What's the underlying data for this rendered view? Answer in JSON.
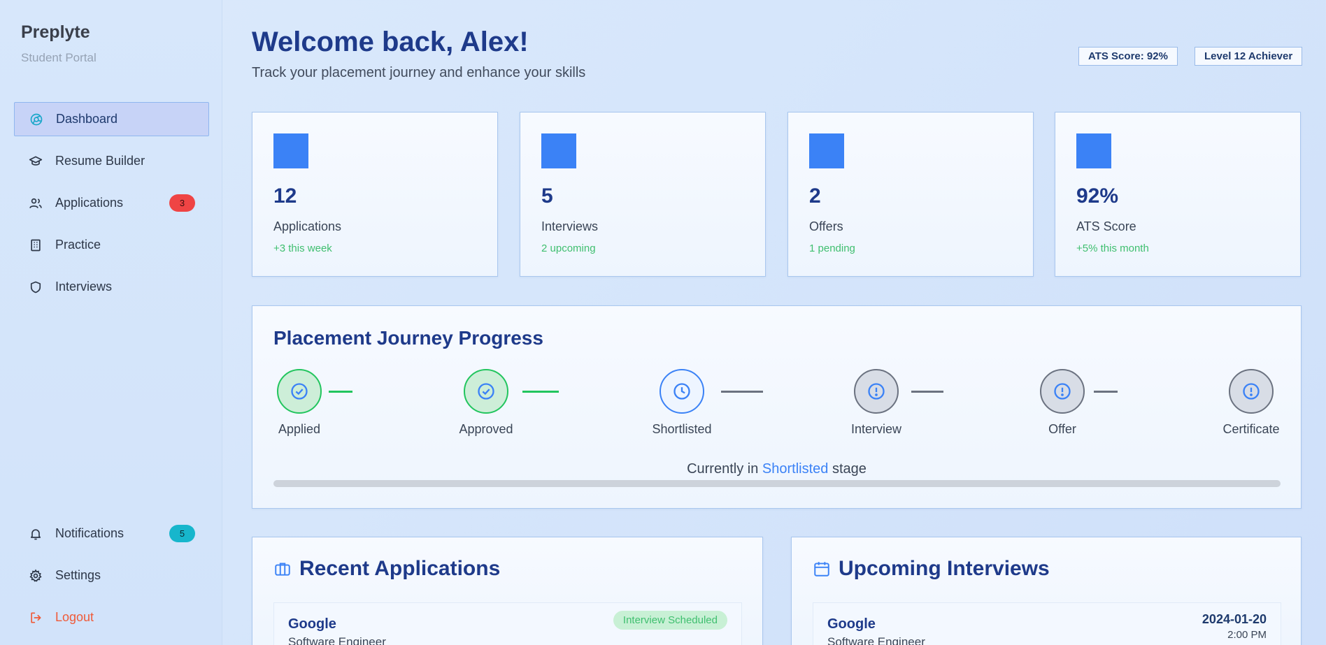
{
  "brand": {
    "name": "Preplyte",
    "subtitle": "Student Portal"
  },
  "nav": {
    "items": [
      {
        "label": "Dashboard",
        "icon": "dashboard-icon",
        "active": true
      },
      {
        "label": "Resume Builder",
        "icon": "graduation-cap-icon"
      },
      {
        "label": "Applications",
        "icon": "users-icon",
        "badge": "3"
      },
      {
        "label": "Practice",
        "icon": "building-icon"
      },
      {
        "label": "Interviews",
        "icon": "shield-icon"
      }
    ],
    "bottom": [
      {
        "label": "Notifications",
        "icon": "bell-icon",
        "badge": "5"
      },
      {
        "label": "Settings",
        "icon": "gear-icon"
      },
      {
        "label": "Logout",
        "icon": "logout-icon"
      }
    ]
  },
  "header": {
    "title": "Welcome back, Alex!",
    "subtitle": "Track your placement journey and enhance your skills",
    "ats_pill": "ATS Score: 92%",
    "level_pill": "Level 12 Achiever"
  },
  "stats": [
    {
      "value": "12",
      "label": "Applications",
      "delta": "+3 this week"
    },
    {
      "value": "5",
      "label": "Interviews",
      "delta": "2 upcoming"
    },
    {
      "value": "2",
      "label": "Offers",
      "delta": "1 pending"
    },
    {
      "value": "92%",
      "label": "ATS Score",
      "delta": "+5% this month"
    }
  ],
  "journey": {
    "title": "Placement Journey Progress",
    "steps": [
      {
        "name": "Applied",
        "state": "done"
      },
      {
        "name": "Approved",
        "state": "done"
      },
      {
        "name": "Shortlisted",
        "state": "current"
      },
      {
        "name": "Interview",
        "state": "pending"
      },
      {
        "name": "Offer",
        "state": "pending"
      },
      {
        "name": "Certificate",
        "state": "pending"
      }
    ],
    "current_prefix": "Currently in",
    "current_stage": "Shortlisted",
    "current_suffix": "stage"
  },
  "recent_applications": {
    "title": "Recent Applications",
    "items": [
      {
        "company": "Google",
        "role": "Software Engineer",
        "status": "Interview Scheduled"
      }
    ]
  },
  "upcoming_interviews": {
    "title": "Upcoming Interviews",
    "items": [
      {
        "company": "Google",
        "role": "Software Engineer",
        "date": "2024-01-20",
        "time": "2:00 PM"
      }
    ]
  },
  "colors": {
    "accent": "#3b82f6",
    "heading": "#1e3a8a",
    "success": "#22c55e",
    "danger": "#ef4444",
    "logout": "#ef5a38"
  }
}
